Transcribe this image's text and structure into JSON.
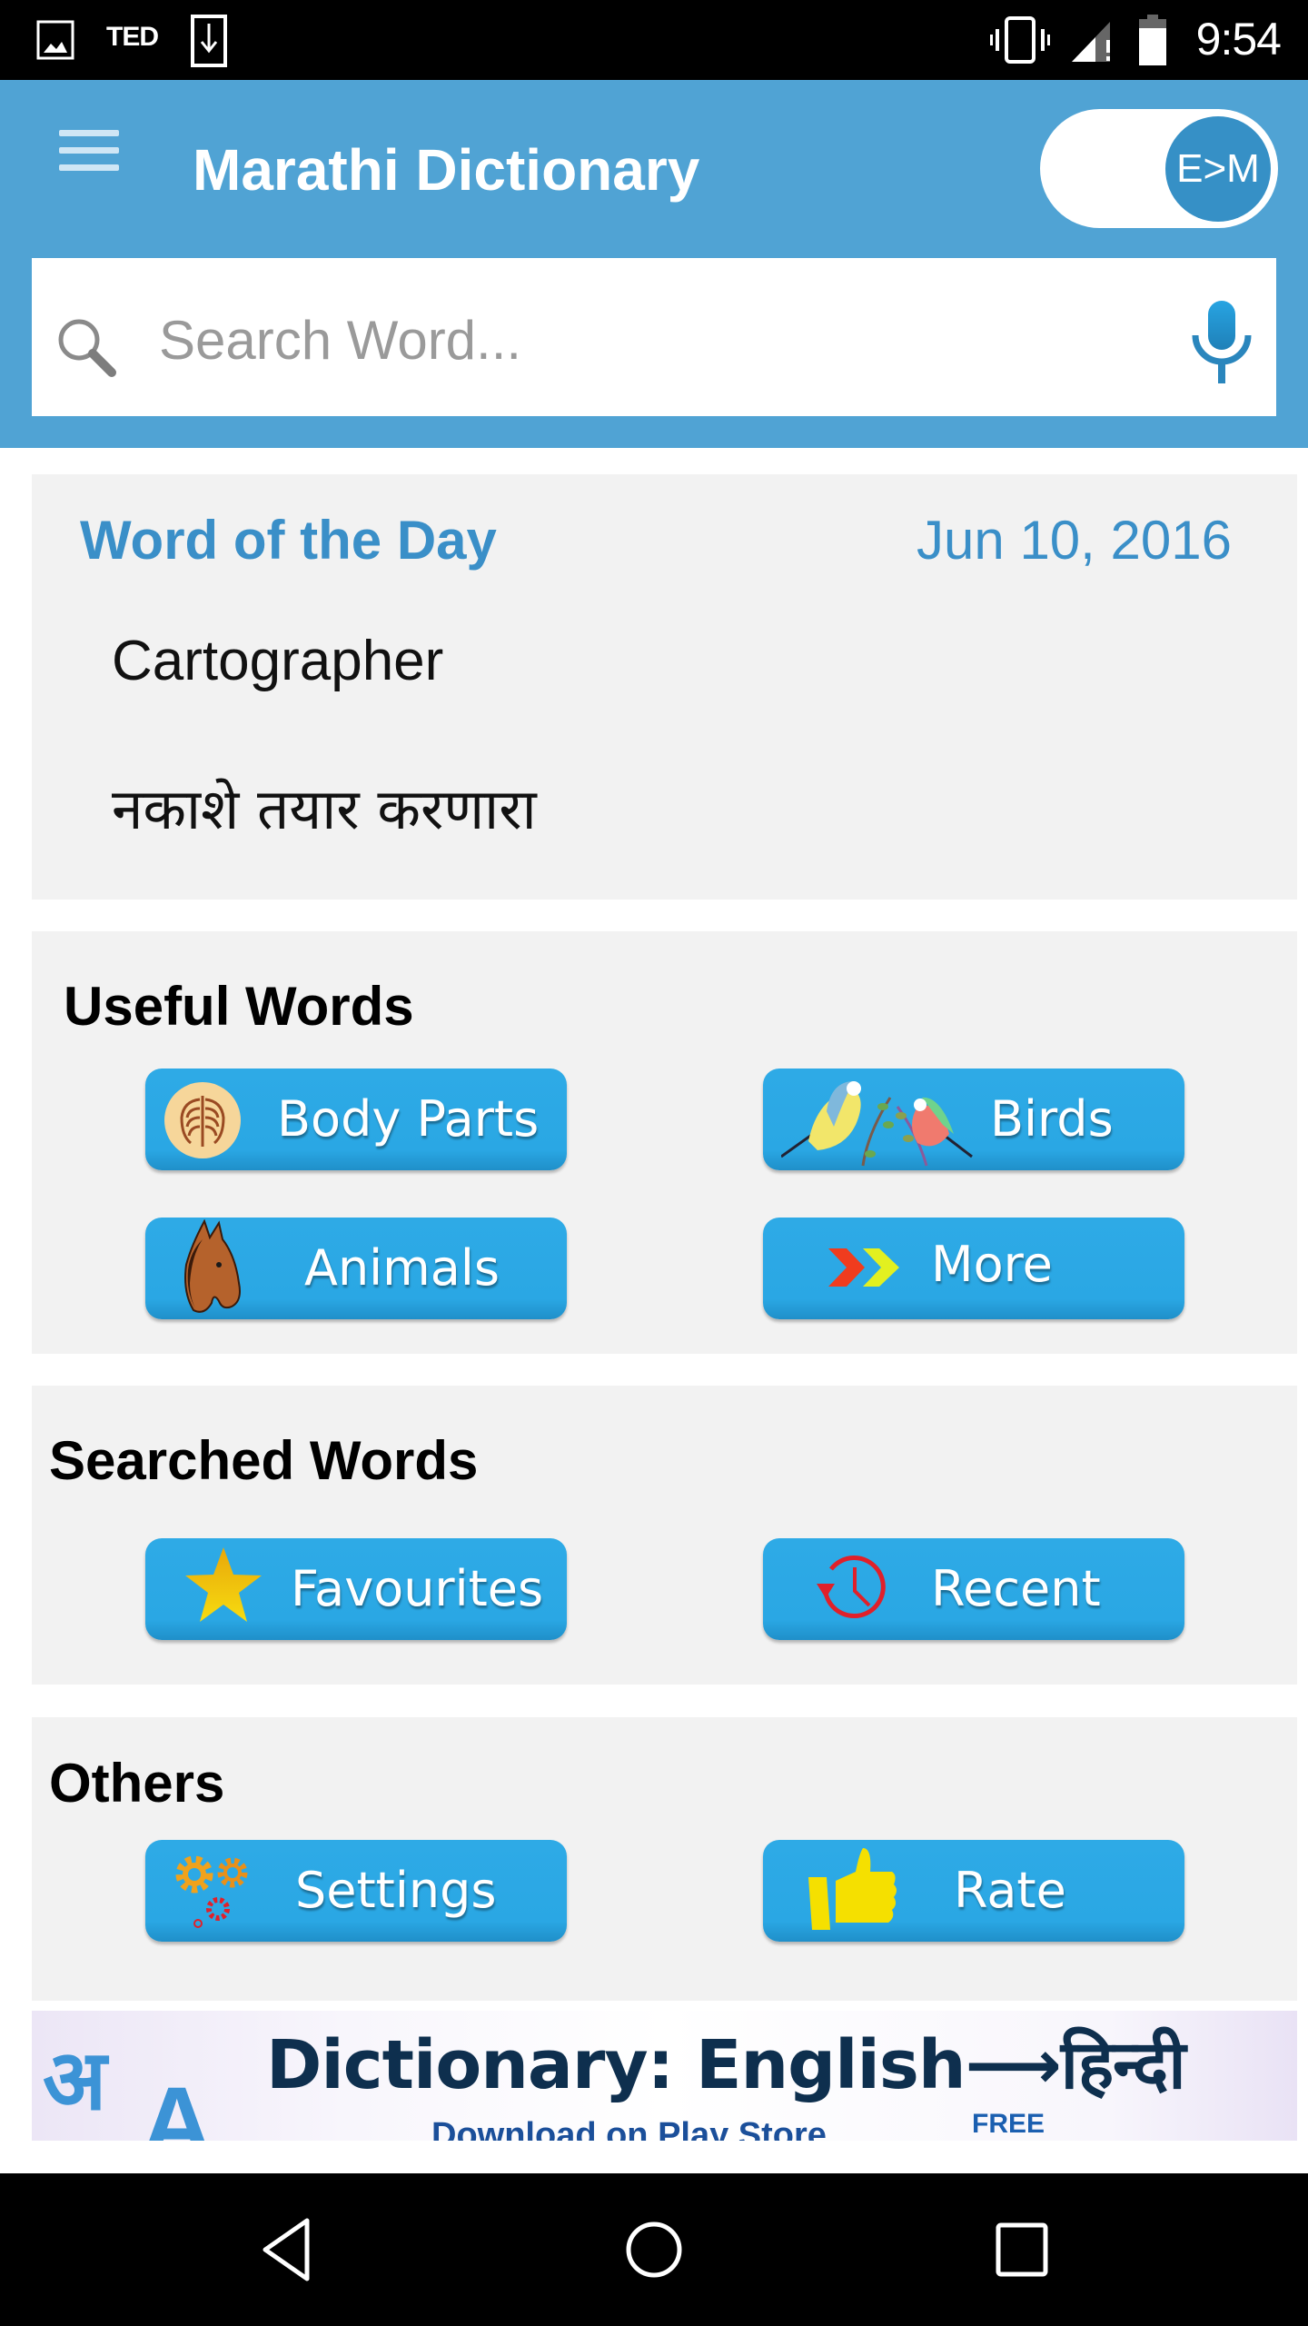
{
  "status_bar": {
    "notification_icons": [
      "image-icon",
      "ted-icon",
      "download-icon"
    ],
    "ted_label": "TED",
    "system_icons": [
      "vibrate-icon",
      "signal-icon",
      "battery-icon"
    ],
    "time": "9:54"
  },
  "header": {
    "menu_icon": "hamburger-menu-icon",
    "title": "Marathi Dictionary",
    "language_toggle": {
      "label": "E>M",
      "state": "on"
    },
    "search": {
      "placeholder": "Search Word...",
      "value": "",
      "search_icon": "magnifier-icon",
      "voice_icon": "microphone-icon"
    },
    "colors": {
      "header_bg": "#50a3d4",
      "toggle_knob": "#3690c6"
    }
  },
  "word_of_the_day": {
    "heading": "Word of the Day",
    "date": "Jun 10, 2016",
    "word": "Cartographer",
    "meaning": "नकाशे तयार करणारा",
    "accent_color": "#3a8fc8"
  },
  "sections": [
    {
      "title": "Useful Words",
      "buttons": [
        {
          "label": "Body Parts",
          "icon": "ribcage-icon"
        },
        {
          "label": "Birds",
          "icon": "birds-icon"
        },
        {
          "label": "Animals",
          "icon": "horse-icon"
        },
        {
          "label": "More",
          "icon": "double-chevron-icon"
        }
      ]
    },
    {
      "title": "Searched Words",
      "buttons": [
        {
          "label": "Favourites",
          "icon": "star-icon"
        },
        {
          "label": "Recent",
          "icon": "history-clock-icon"
        }
      ]
    },
    {
      "title": "Others",
      "buttons": [
        {
          "label": "Settings",
          "icon": "gears-icon"
        },
        {
          "label": "Rate",
          "icon": "thumbs-up-icon"
        }
      ]
    }
  ],
  "ad_banner": {
    "logo_devanagari": "अ",
    "logo_latin": "A",
    "headline_prefix": "Dictionary: English",
    "arrow": "⟶",
    "headline_suffix": "हिन्दी",
    "subline": "Download on Play Store",
    "badge": "FREE"
  },
  "nav_bar": {
    "buttons": [
      "back-icon",
      "home-icon",
      "recents-icon"
    ]
  }
}
